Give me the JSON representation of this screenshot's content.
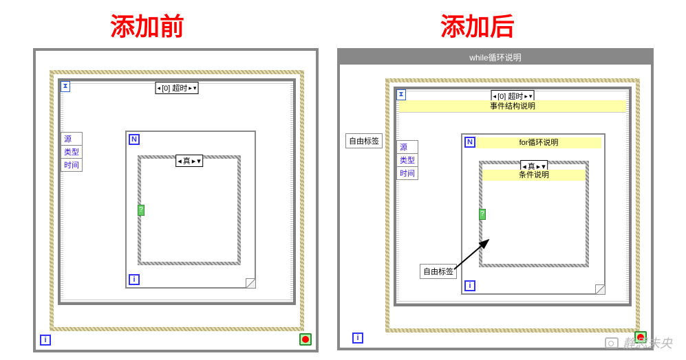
{
  "titles": {
    "before": "添加前",
    "after": "添加后"
  },
  "while_subdiagram_label": "while循环说明",
  "event_selector": {
    "prev": "◂",
    "label": "[0] 超时",
    "next": "▸",
    "menu": "▾"
  },
  "event_desc": "事件结构说明",
  "terminals": {
    "source": "源",
    "type": "类型",
    "time": "时间"
  },
  "for_desc": "for循环说明",
  "for_n": "N",
  "for_i": "i",
  "case_selector": {
    "prev": "◂",
    "label": "真",
    "next": "▸",
    "menu": "▾"
  },
  "case_desc": "条件说明",
  "free_label": "自由标签",
  "hourglass": "⧗",
  "case_q": "?",
  "while_i": "i",
  "watermark": "静思未央"
}
